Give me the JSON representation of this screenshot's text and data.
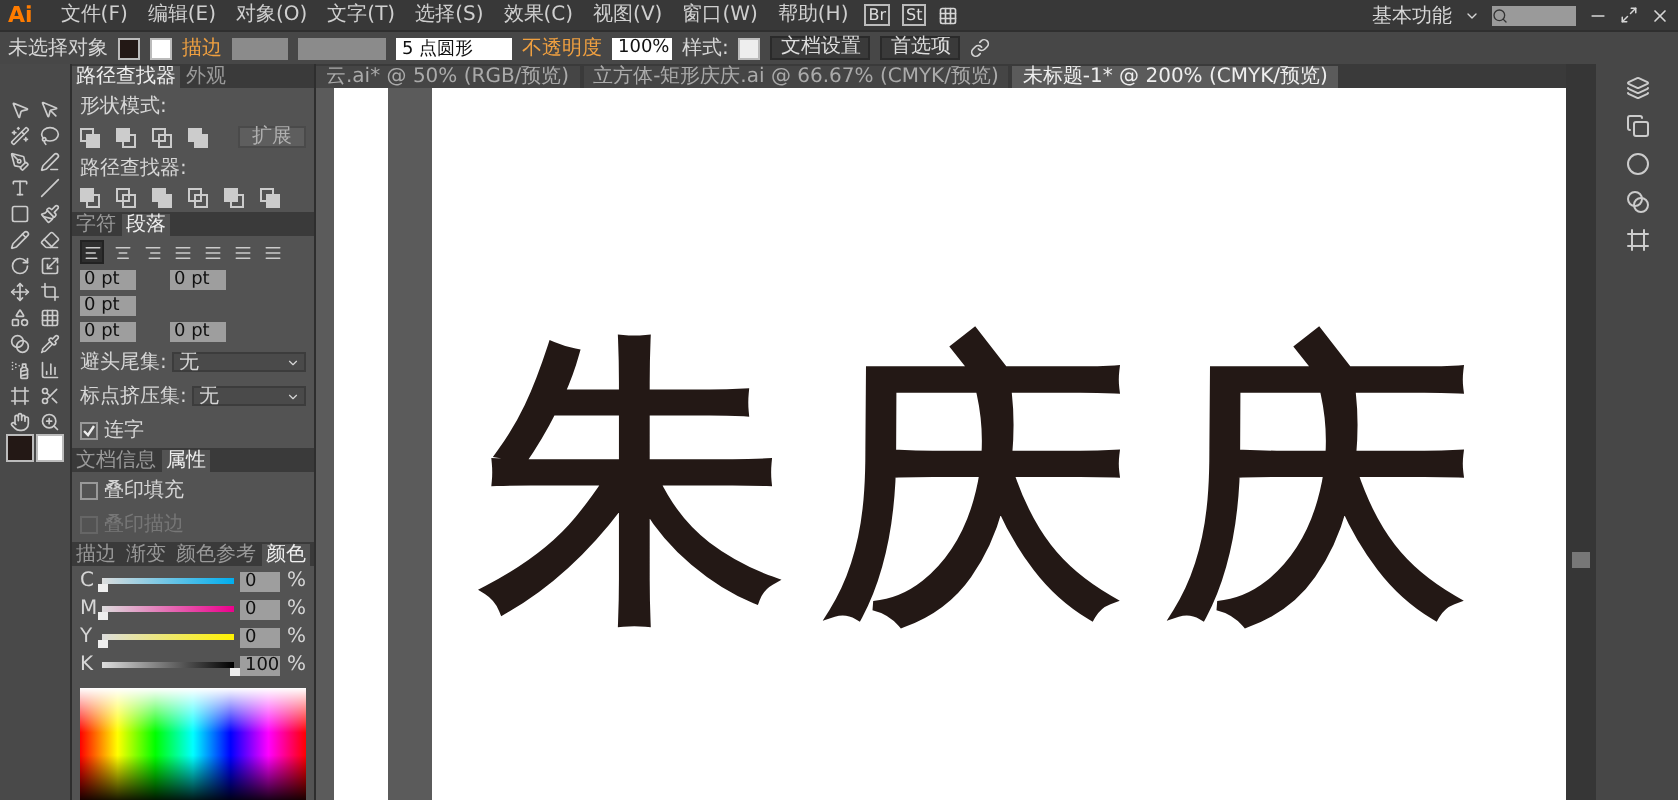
{
  "menu_bar": {
    "logo": "Ai",
    "items": [
      "文件(F)",
      "编辑(E)",
      "对象(O)",
      "文字(T)",
      "选择(S)",
      "效果(C)",
      "视图(V)",
      "窗口(W)",
      "帮助(H)"
    ],
    "bridge": "Br",
    "stock": "St",
    "workspace": "基本功能"
  },
  "control_bar": {
    "selection": "未选择对象",
    "stroke_label": "描边",
    "brush": "5 点圆形",
    "opacity_label": "不透明度",
    "opacity": "100%",
    "style_label": "样式:",
    "buttons": [
      "文档设置",
      "首选项"
    ]
  },
  "document_tabs": [
    {
      "label": "云.ai* @ 50% (RGB/预览)",
      "selected": false
    },
    {
      "label": "立方体-矩形庆庆.ai @ 66.67% (CMYK/预览)",
      "selected": false
    },
    {
      "label": "未标题-1* @ 200% (CMYK/预览)",
      "selected": true
    }
  ],
  "pathfinder_panel": {
    "tabs": [
      {
        "label": "路径查找器",
        "selected": true
      },
      {
        "label": "外观",
        "selected": false
      }
    ],
    "shape_modes_label": "形状模式:",
    "expand_button": {
      "label": "扩展",
      "disabled": true
    },
    "pathfinders_label": "路径查找器:"
  },
  "paragraph_panel": {
    "tabs": [
      {
        "label": "字符",
        "selected": false
      },
      {
        "label": "段落",
        "selected": true
      }
    ],
    "alignment": [
      {
        "kind": "left",
        "selected": true
      },
      {
        "kind": "center",
        "selected": false
      },
      {
        "kind": "right",
        "selected": false
      },
      {
        "kind": "justify",
        "selected": false
      },
      {
        "kind": "justify",
        "selected": false
      },
      {
        "kind": "justify",
        "selected": false
      },
      {
        "kind": "justify",
        "selected": false
      }
    ],
    "indents": [
      "0 pt",
      "0 pt",
      "0 pt",
      "0 pt",
      "0 pt"
    ],
    "kinsoku": {
      "label": "避头尾集:",
      "value": "无"
    },
    "mojikumi": {
      "label": "标点挤压集:",
      "value": "无"
    },
    "hyphenation": {
      "label": "连字",
      "checked": true
    }
  },
  "attributes_panel": {
    "tabs": [
      {
        "label": "文档信息",
        "selected": false
      },
      {
        "label": "属性",
        "selected": true
      }
    ],
    "options": [
      {
        "label": "叠印填充",
        "checked": false,
        "disabled": false
      },
      {
        "label": "叠印描边",
        "checked": false,
        "disabled": true
      }
    ]
  },
  "color_panel": {
    "tabs": [
      {
        "label": "描边",
        "selected": false
      },
      {
        "label": "渐变",
        "selected": false
      },
      {
        "label": "颜色参考",
        "selected": false
      },
      {
        "label": "颜色",
        "selected": true
      }
    ],
    "channels": [
      {
        "name": "C",
        "level": 0,
        "reading": "0",
        "unit": "%"
      },
      {
        "name": "M",
        "level": 0,
        "reading": "0",
        "unit": "%"
      },
      {
        "name": "Y",
        "level": 0,
        "reading": "0",
        "unit": "%"
      },
      {
        "name": "K",
        "level": 1,
        "reading": "100",
        "unit": "%"
      }
    ]
  },
  "artboard": {
    "text": "朱庆庆"
  }
}
